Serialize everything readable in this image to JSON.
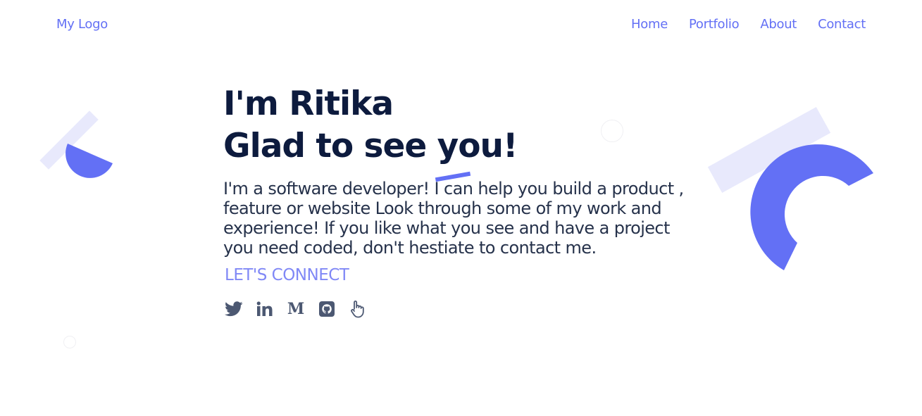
{
  "header": {
    "logo": "My Logo",
    "nav": [
      {
        "label": "Home"
      },
      {
        "label": "Portfolio"
      },
      {
        "label": "About"
      },
      {
        "label": "Contact"
      }
    ]
  },
  "hero": {
    "title_line1": "I'm Ritika",
    "title_line2": "Glad to see you!",
    "description": "I'm a software developer! I can help you build a product , feature or website Look through some of my work and experience! If you like what you see and have a project you need coded, don't hestiate to contact me.",
    "cta": "LET'S CONNECT"
  },
  "socials": [
    {
      "icon": "twitter-icon"
    },
    {
      "icon": "linkedin-icon"
    },
    {
      "icon": "medium-icon",
      "text": "M"
    },
    {
      "icon": "github-icon"
    },
    {
      "icon": "hand-icon"
    }
  ],
  "colors": {
    "accent": "#6370f5",
    "accent_light": "#e8e9fc",
    "heading": "#0d1b3e",
    "body_text": "#26324b",
    "icon": "#4c5872"
  }
}
